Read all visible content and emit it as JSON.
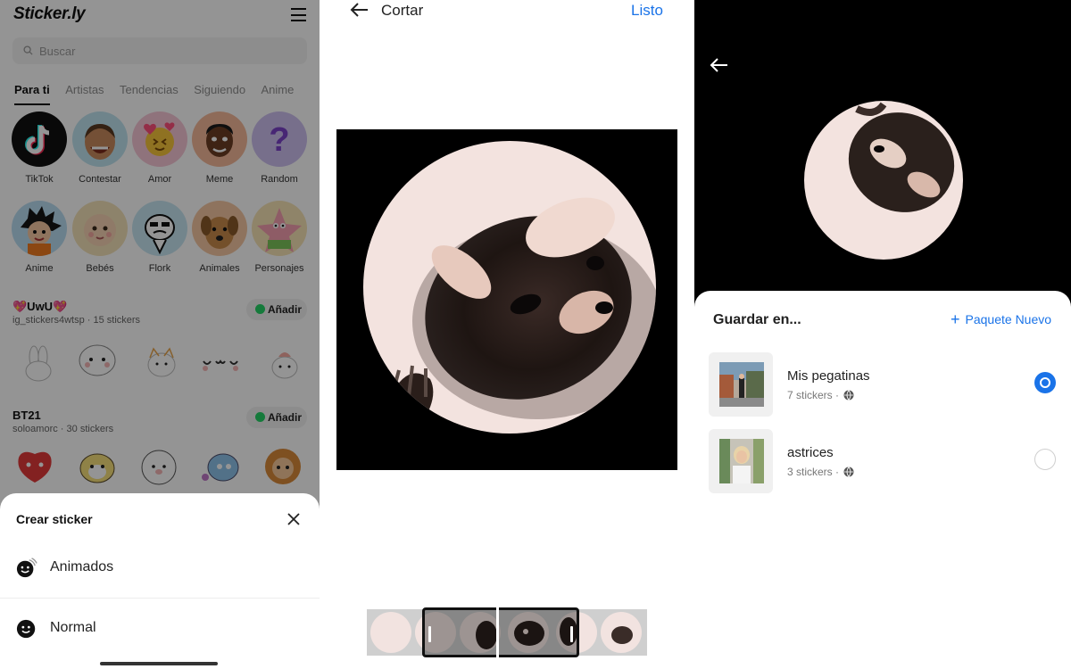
{
  "screen_left": {
    "app_logo": "Sticker.ly",
    "search": {
      "placeholder": "Buscar"
    },
    "tabs": [
      {
        "label": "Para ti",
        "active": true
      },
      {
        "label": "Artistas"
      },
      {
        "label": "Tendencias"
      },
      {
        "label": "Siguiendo"
      },
      {
        "label": "Anime"
      }
    ],
    "categories": [
      {
        "label": "TikTok",
        "icon": "tiktok-icon"
      },
      {
        "label": "Contestar",
        "icon": "laughing-man-icon"
      },
      {
        "label": "Amor",
        "icon": "love-emoji-icon"
      },
      {
        "label": "Meme",
        "icon": "meme-face-icon"
      },
      {
        "label": "Random",
        "icon": "question-mark-icon"
      },
      {
        "label": "Anime",
        "icon": "anime-character-icon"
      },
      {
        "label": "Bebés",
        "icon": "baby-icon"
      },
      {
        "label": "Flork",
        "icon": "flork-icon"
      },
      {
        "label": "Animales",
        "icon": "dog-icon"
      },
      {
        "label": "Personajes",
        "icon": "patrick-star-icon"
      }
    ],
    "packs": [
      {
        "title": "💖UwU💖",
        "author": "ig_stickers4wtsp",
        "count": "15 stickers",
        "add_label": "Añadir"
      },
      {
        "title": "BT21",
        "author": "soloamorc",
        "count": "30 stickers",
        "add_label": "Añadir"
      }
    ],
    "create_sheet": {
      "title": "Crear sticker",
      "options": [
        {
          "label": "Animados",
          "icon": "animated-smiley-icon"
        },
        {
          "label": "Normal",
          "icon": "smiley-icon"
        }
      ]
    }
  },
  "screen_middle": {
    "title": "Cortar",
    "done_label": "Listo"
  },
  "screen_right": {
    "save_title": "Guardar en...",
    "new_pack_label": "Paquete Nuevo",
    "packs": [
      {
        "name": "Mis pegatinas",
        "count": "7 stickers",
        "selected": true
      },
      {
        "name": "astrices",
        "count": "3 stickers",
        "selected": false
      }
    ]
  },
  "colors": {
    "accent_blue": "#1a73e8",
    "whatsapp_green": "#25d366",
    "sticker_bg": "#f2e3e0"
  }
}
